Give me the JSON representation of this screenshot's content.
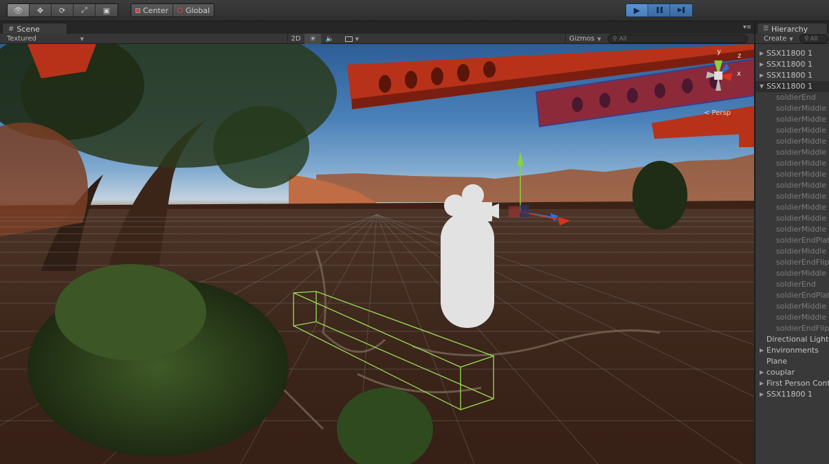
{
  "toolbar": {
    "tools": [
      {
        "name": "view-tool",
        "icon": "eye-icon",
        "glyph": "👁"
      },
      {
        "name": "move-tool",
        "icon": "move-arrows-icon",
        "glyph": "✥"
      },
      {
        "name": "rotate-tool",
        "icon": "rotate-icon",
        "glyph": "⟳"
      },
      {
        "name": "scale-tool",
        "icon": "scale-icon",
        "glyph": "⤢"
      },
      {
        "name": "rect-tool",
        "icon": "rect-transform-icon",
        "glyph": "▣"
      }
    ],
    "pivot_label": "Center",
    "space_label": "Global",
    "play_glyph": "▶",
    "pause_glyph": "❚❚",
    "step_glyph": "▶❚"
  },
  "scene": {
    "tab_label": "Scene",
    "tab_menu_glyph": "▾≡",
    "shading_mode": "Textured",
    "mode_2d": "2D",
    "gizmos_label": "Gizmos",
    "search_placeholder": "All",
    "persp_label": "< Persp",
    "axis_labels": {
      "y": "y",
      "z": "z",
      "x": "x"
    }
  },
  "hierarchy": {
    "tab_label": "Hierarchy",
    "create_label": "Create",
    "search_placeholder": "All",
    "items": [
      {
        "label": "SSX11800 1",
        "fold": "right",
        "level": 0
      },
      {
        "label": "SSX11800 1",
        "fold": "right",
        "level": 0
      },
      {
        "label": "SSX11800 1",
        "fold": "right",
        "level": 0
      },
      {
        "label": "SSX11800 1",
        "fold": "down",
        "level": 0,
        "selected": true
      },
      {
        "label": "soldierEnd",
        "fold": "",
        "level": 1
      },
      {
        "label": "soldierMiddle",
        "fold": "",
        "level": 1
      },
      {
        "label": "soldierMiddle",
        "fold": "",
        "level": 1
      },
      {
        "label": "soldierMiddle",
        "fold": "",
        "level": 1
      },
      {
        "label": "soldierMiddle",
        "fold": "",
        "level": 1
      },
      {
        "label": "soldierMiddle",
        "fold": "",
        "level": 1
      },
      {
        "label": "soldierMiddle",
        "fold": "",
        "level": 1
      },
      {
        "label": "soldierMiddle",
        "fold": "",
        "level": 1
      },
      {
        "label": "soldierMiddle",
        "fold": "",
        "level": 1
      },
      {
        "label": "soldierMiddle",
        "fold": "",
        "level": 1
      },
      {
        "label": "soldierMiddle",
        "fold": "",
        "level": 1
      },
      {
        "label": "soldierMiddle",
        "fold": "",
        "level": 1
      },
      {
        "label": "soldierMiddle",
        "fold": "",
        "level": 1
      },
      {
        "label": "soldierEndPlat",
        "fold": "",
        "level": 1
      },
      {
        "label": "soldierMiddle",
        "fold": "",
        "level": 1
      },
      {
        "label": "soldierEndFlip",
        "fold": "",
        "level": 1
      },
      {
        "label": "soldierMiddle",
        "fold": "",
        "level": 1
      },
      {
        "label": "soldierEnd",
        "fold": "",
        "level": 1
      },
      {
        "label": "soldierEndPlat",
        "fold": "",
        "level": 1
      },
      {
        "label": "soldierMiddle",
        "fold": "",
        "level": 1
      },
      {
        "label": "soldierMiddle",
        "fold": "",
        "level": 1
      },
      {
        "label": "soldierEndFlip",
        "fold": "",
        "level": 1
      },
      {
        "label": "Directional Light",
        "fold": "",
        "level": 0
      },
      {
        "label": "Environments",
        "fold": "right",
        "level": 0
      },
      {
        "label": "Plane",
        "fold": "",
        "level": 0
      },
      {
        "label": "couplar",
        "fold": "right",
        "level": 0
      },
      {
        "label": "First Person Controller",
        "fold": "right",
        "level": 0
      },
      {
        "label": "SSX11800 1",
        "fold": "right",
        "level": 0
      }
    ]
  },
  "colors": {
    "play_accent": "#3a6aa0",
    "girder_red": "#b8321a",
    "selection_green": "#9be05a",
    "axis_x": "#d8321c",
    "axis_y": "#8bd23c",
    "axis_z": "#2f6ed8"
  }
}
